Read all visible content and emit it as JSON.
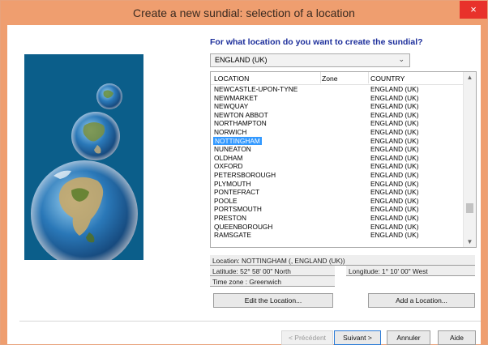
{
  "window": {
    "title": "Create a new sundial: selection of a location",
    "close_icon": "close-icon",
    "close_glyph": "×"
  },
  "prompt": "For what location do you want to create the sundial?",
  "country_select": {
    "value": "ENGLAND (UK)",
    "chevron": "chevron-down-icon"
  },
  "list": {
    "headers": {
      "location": "LOCATION",
      "zone": "Zone",
      "country": "COUNTRY"
    },
    "rows": [
      {
        "location": "NEWCASTLE-UPON-TYNE",
        "zone": "",
        "country": "ENGLAND (UK)"
      },
      {
        "location": "NEWMARKET",
        "zone": "",
        "country": "ENGLAND (UK)"
      },
      {
        "location": "NEWQUAY",
        "zone": "",
        "country": "ENGLAND (UK)"
      },
      {
        "location": "NEWTON ABBOT",
        "zone": "",
        "country": "ENGLAND (UK)"
      },
      {
        "location": "NORTHAMPTON",
        "zone": "",
        "country": "ENGLAND (UK)"
      },
      {
        "location": "NORWICH",
        "zone": "",
        "country": "ENGLAND (UK)"
      },
      {
        "location": "NOTTINGHAM",
        "zone": "",
        "country": "ENGLAND (UK)",
        "selected": true
      },
      {
        "location": "NUNEATON",
        "zone": "",
        "country": "ENGLAND (UK)"
      },
      {
        "location": "OLDHAM",
        "zone": "",
        "country": "ENGLAND (UK)"
      },
      {
        "location": "OXFORD",
        "zone": "",
        "country": "ENGLAND (UK)"
      },
      {
        "location": "PETERSBOROUGH",
        "zone": "",
        "country": "ENGLAND (UK)"
      },
      {
        "location": "PLYMOUTH",
        "zone": "",
        "country": "ENGLAND (UK)"
      },
      {
        "location": "PONTEFRACT",
        "zone": "",
        "country": "ENGLAND (UK)"
      },
      {
        "location": "POOLE",
        "zone": "",
        "country": "ENGLAND (UK)"
      },
      {
        "location": "PORTSMOUTH",
        "zone": "",
        "country": "ENGLAND (UK)"
      },
      {
        "location": "PRESTON",
        "zone": "",
        "country": "ENGLAND (UK)"
      },
      {
        "location": "QUEENBOROUGH",
        "zone": "",
        "country": "ENGLAND (UK)"
      },
      {
        "location": "RAMSGATE",
        "zone": "",
        "country": "ENGLAND (UK)"
      }
    ],
    "scroll_up": "▲",
    "scroll_down": "▼"
  },
  "details": {
    "location_label": "Location: NOTTINGHAM (, ENGLAND (UK))",
    "latitude_label": "Latitude: 52° 58' 00\" North",
    "longitude_label": "Longitude: 1° 10' 00\" West",
    "timezone_label": "Time zone : Greenwich"
  },
  "buttons": {
    "edit_location": "Edit the Location...",
    "add_location": "Add a Location...",
    "previous": "< Précédent",
    "next": "Suivant >",
    "cancel": "Annuler",
    "help": "Aide"
  },
  "colors": {
    "titlebar": "#ef9e6f",
    "selection": "#3399ff",
    "prompt": "#1c2e9b"
  }
}
